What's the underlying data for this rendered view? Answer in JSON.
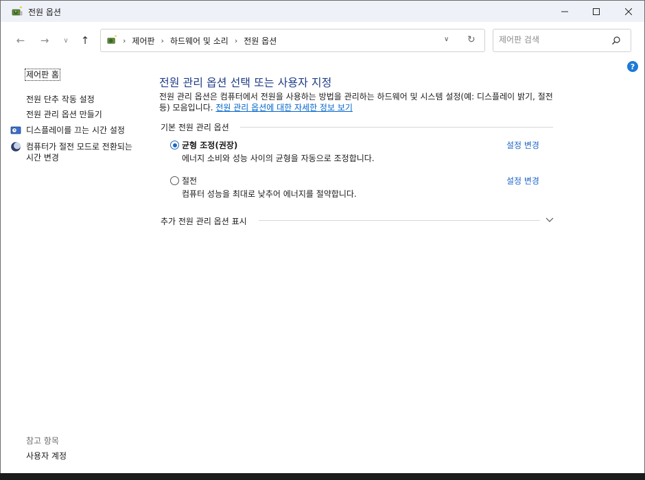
{
  "window": {
    "title": "전원 옵션",
    "minimize_label": "—",
    "maximize_label": "☐",
    "close_label": "✕"
  },
  "nav": {
    "back_glyph": "←",
    "forward_glyph": "→",
    "recent_glyph": "∨",
    "up_glyph": "↑"
  },
  "address": {
    "crumbs": [
      "제어판",
      "하드웨어 및 소리",
      "전원 옵션"
    ],
    "separator": "›",
    "dropdown_glyph": "∨",
    "refresh_glyph": "↻"
  },
  "search": {
    "placeholder": "제어판 검색",
    "value": ""
  },
  "help": {
    "label": "?"
  },
  "left_pane": {
    "home": "제어판 홈",
    "links": [
      "전원 단추 작동 설정",
      "전원 관리 옵션 만들기",
      "디스플레이를 끄는 시간 설정",
      "컴퓨터가 절전 모드로 전환되는 시간 변경"
    ],
    "see_also_title": "참고 항목",
    "see_also_links": [
      "사용자 계정"
    ]
  },
  "main": {
    "heading": "전원 관리 옵션 선택 또는 사용자 지정",
    "description": "전원 관리 옵션은 컴퓨터에서 전원을 사용하는 방법을 관리하는 하드웨어 및 시스템 설정(예: 디스플레이 밝기, 절전 등) 모음입니다. ",
    "description_link": "전원 관리 옵션에 대한 자세한 정보 보기",
    "group_label": "기본 전원 관리 옵션",
    "plans": [
      {
        "name": "균형 조정(권장)",
        "desc": "에너지 소비와 성능 사이의 균형을 자동으로 조정합니다.",
        "link": "설정 변경",
        "selected": true
      },
      {
        "name": "절전",
        "desc": "컴퓨터 성능을 최대로 낮추어 에너지를 절약합니다.",
        "link": "설정 변경",
        "selected": false
      }
    ],
    "more_label": "추가 전원 관리 옵션 표시"
  },
  "colors": {
    "accent": "#1f66c1",
    "heading": "#1f3c88",
    "link": "#0066cc",
    "titlebar_bg": "#eef1f7"
  },
  "icons": [
    "power-options-icon",
    "back-arrow-icon",
    "forward-arrow-icon",
    "recent-chevron-icon",
    "up-arrow-icon",
    "dropdown-chevron-icon",
    "refresh-icon",
    "search-icon",
    "help-icon",
    "display-clock-icon",
    "moon-sleep-icon",
    "chevron-down-icon"
  ]
}
